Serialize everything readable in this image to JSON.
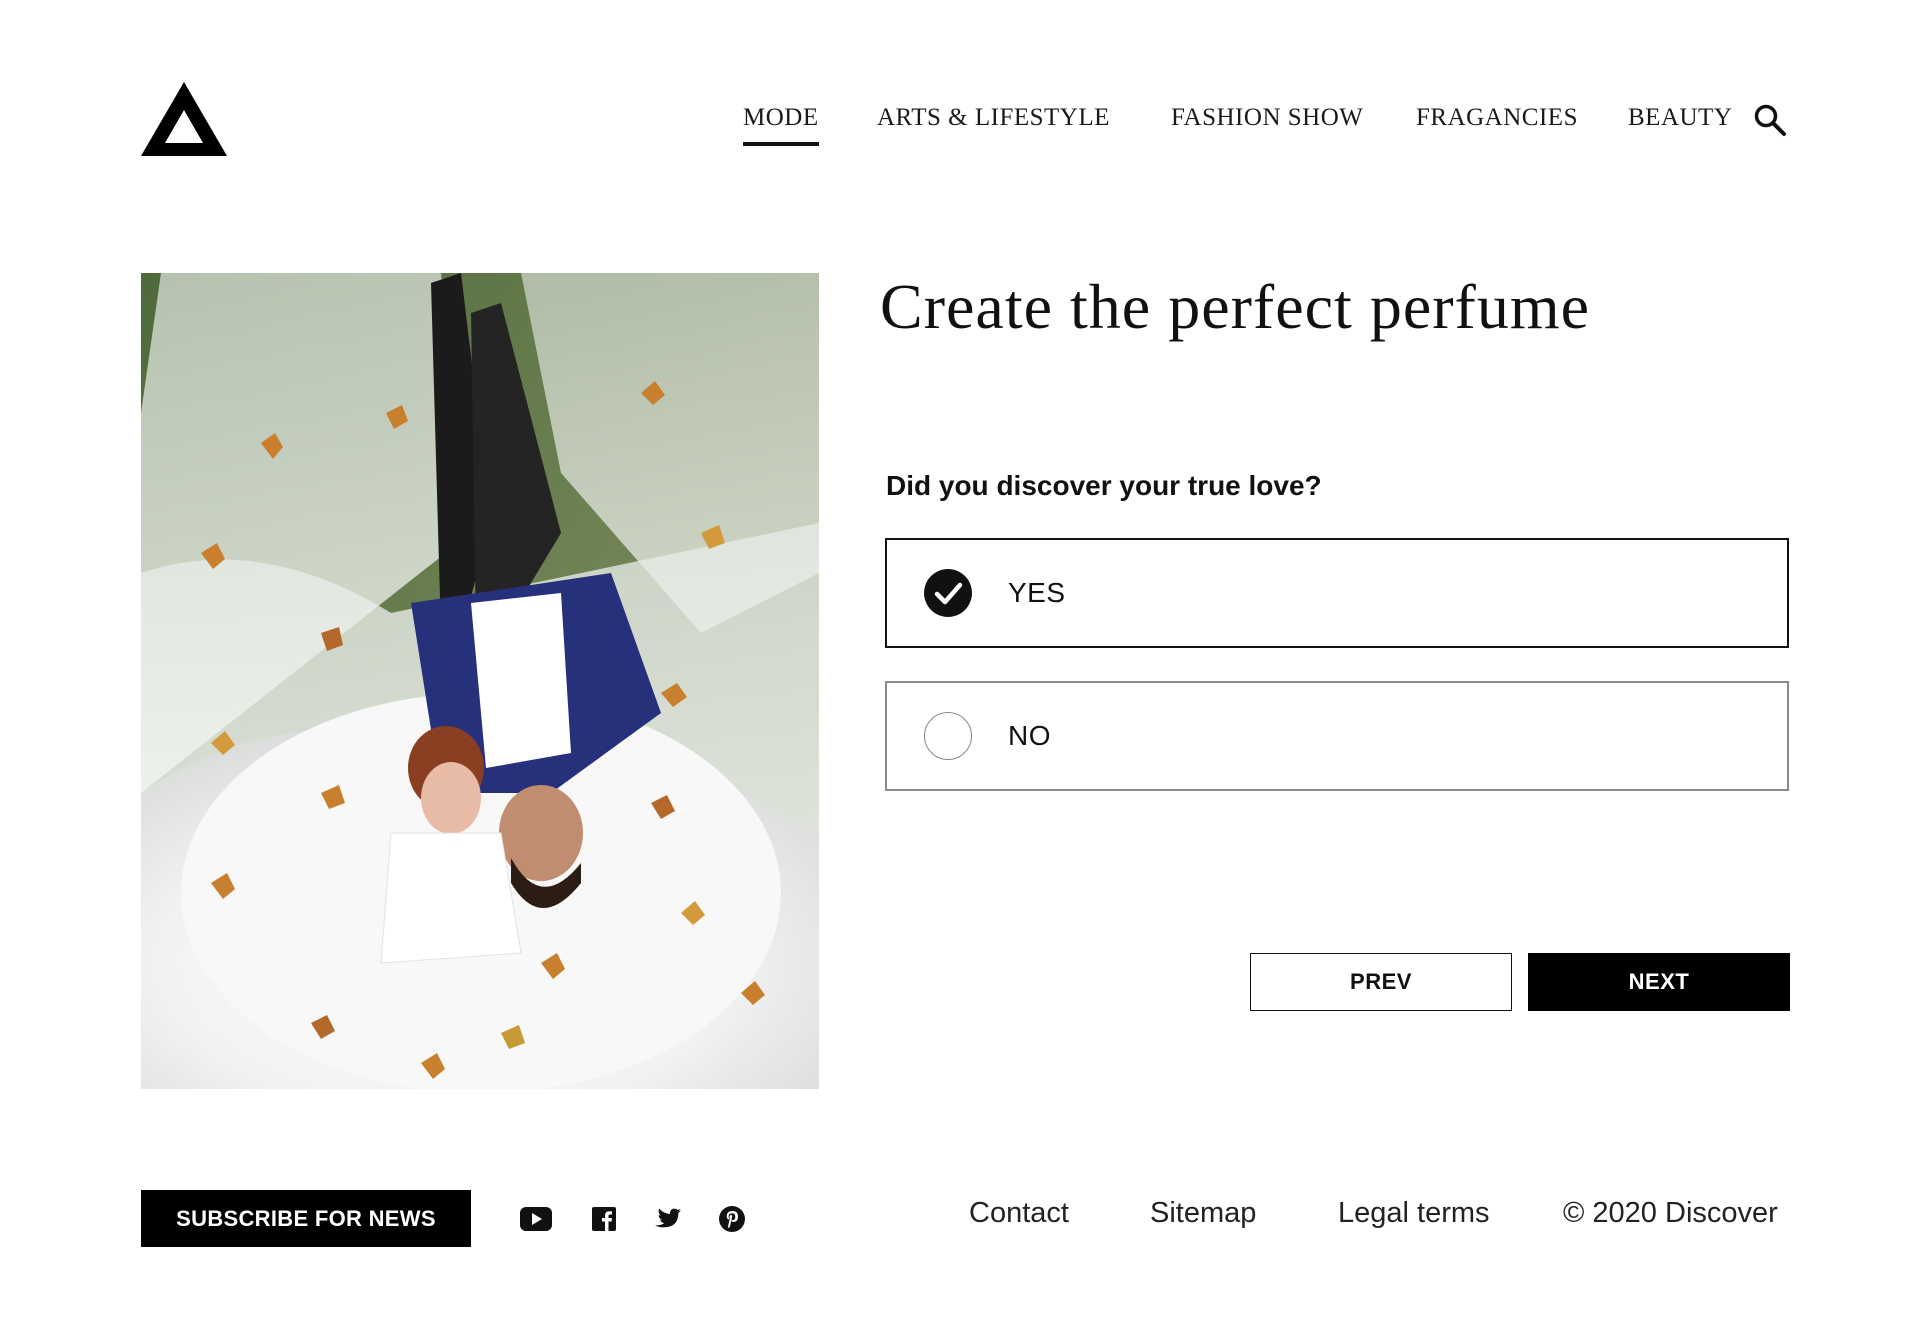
{
  "brand": {
    "logo_icon": "triangle-logo-icon"
  },
  "nav": {
    "items": [
      {
        "label": "MODE",
        "active": true
      },
      {
        "label": "ARTS & LIFESTYLE",
        "active": false
      },
      {
        "label": "FASHION SHOW",
        "active": false
      },
      {
        "label": "FRAGANCIES",
        "active": false
      },
      {
        "label": "BEAUTY",
        "active": false
      }
    ],
    "search_icon": "search-icon"
  },
  "hero": {
    "image": "wedding couple lying on veil with autumn leaves"
  },
  "quiz": {
    "title": "Create the perfect perfume",
    "question": "Did you discover your true love?",
    "options": [
      {
        "label": "YES",
        "selected": true
      },
      {
        "label": "NO",
        "selected": false
      }
    ],
    "prev_label": "PREV",
    "next_label": "NEXT"
  },
  "footer": {
    "subscribe_label": "SUBSCRIBE FOR NEWS",
    "social_icons": [
      "youtube-icon",
      "facebook-icon",
      "twitter-icon",
      "pinterest-icon"
    ],
    "links": [
      "Contact",
      "Sitemap",
      "Legal terms"
    ],
    "copyright": "© 2020 Discover"
  },
  "colors": {
    "primary": "#000000",
    "background": "#ffffff",
    "border_unselected": "#8a8a8a"
  }
}
